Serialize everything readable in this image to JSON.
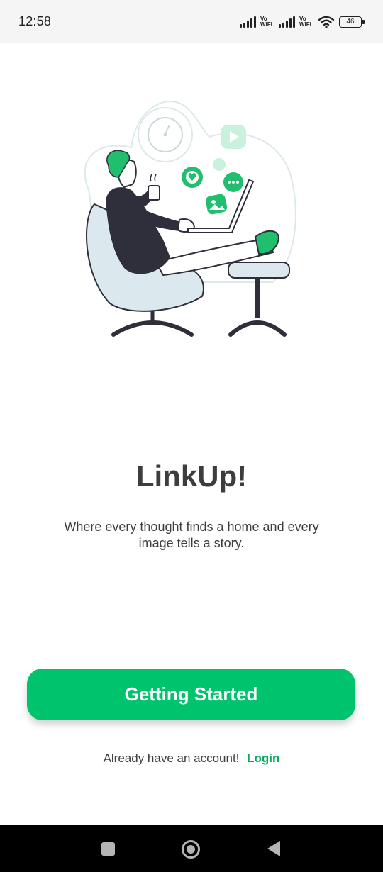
{
  "status_bar": {
    "time": "12:58",
    "sim1_label": "Vo WiFi",
    "sim2_label": "Vo WiFi",
    "battery": "46",
    "icons": [
      "signal-icon",
      "vowifi-icon",
      "signal-icon",
      "vowifi-icon",
      "wifi-icon",
      "battery-icon"
    ]
  },
  "hero": {
    "illustration": "man-relaxing-with-laptop-illustration",
    "icons": [
      "clock-icon",
      "play-icon",
      "heart-icon",
      "chat-bubble-icon",
      "image-icon"
    ]
  },
  "onboarding": {
    "title": "LinkUp!",
    "tagline": "Where every thought finds a home and every image tells a story."
  },
  "actions": {
    "cta_label": "Getting Started",
    "login_prompt": "Already have an account!",
    "login_link": "Login"
  },
  "navigation": {
    "icons": [
      "recent-apps-icon",
      "home-icon",
      "back-icon"
    ]
  },
  "colors": {
    "accent": "#00c36d",
    "link": "#07a95f",
    "text": "#3d3d3d",
    "status_bar_bg": "#f5f5f5",
    "nav_bar_bg": "#000000"
  }
}
